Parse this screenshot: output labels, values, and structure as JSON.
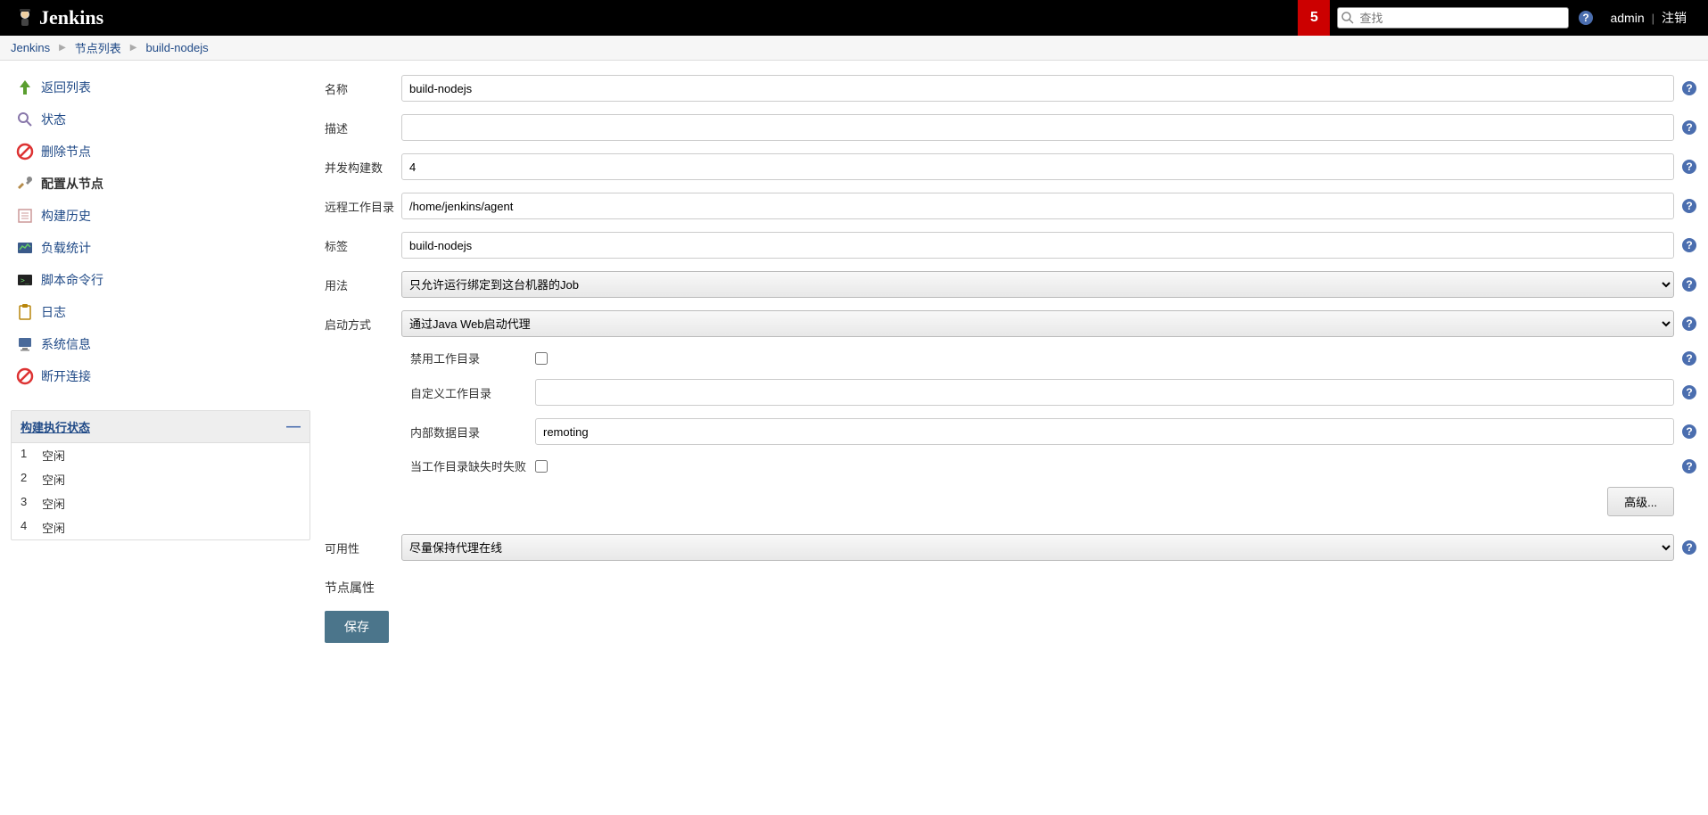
{
  "header": {
    "brand": "Jenkins",
    "notif_count": "5",
    "search_placeholder": "查找",
    "user": "admin",
    "logout": "注销"
  },
  "breadcrumb": {
    "items": [
      "Jenkins",
      "节点列表",
      "build-nodejs"
    ]
  },
  "sidebar": {
    "tasks": [
      {
        "label": "返回列表"
      },
      {
        "label": "状态"
      },
      {
        "label": "删除节点"
      },
      {
        "label": "配置从节点"
      },
      {
        "label": "构建历史"
      },
      {
        "label": "负载统计"
      },
      {
        "label": "脚本命令行"
      },
      {
        "label": "日志"
      },
      {
        "label": "系统信息"
      },
      {
        "label": "断开连接"
      }
    ],
    "executors_title": "构建执行状态",
    "executors": [
      {
        "num": "1",
        "state": "空闲"
      },
      {
        "num": "2",
        "state": "空闲"
      },
      {
        "num": "3",
        "state": "空闲"
      },
      {
        "num": "4",
        "state": "空闲"
      }
    ]
  },
  "form": {
    "labels": {
      "name": "名称",
      "description": "描述",
      "executors": "并发构建数",
      "remote_fs": "远程工作目录",
      "labels": "标签",
      "usage": "用法",
      "launch": "启动方式",
      "disable_workdir": "禁用工作目录",
      "custom_workdir": "自定义工作目录",
      "internal_dir": "内部数据目录",
      "fail_missing": "当工作目录缺失时失败",
      "availability": "可用性",
      "node_props": "节点属性",
      "advanced": "高级...",
      "save": "保存"
    },
    "values": {
      "name": "build-nodejs",
      "description": "",
      "executors": "4",
      "remote_fs": "/home/jenkins/agent",
      "labels": "build-nodejs",
      "usage": "只允许运行绑定到这台机器的Job",
      "launch": "通过Java Web启动代理",
      "custom_workdir": "",
      "internal_dir": "remoting",
      "availability": "尽量保持代理在线"
    }
  }
}
